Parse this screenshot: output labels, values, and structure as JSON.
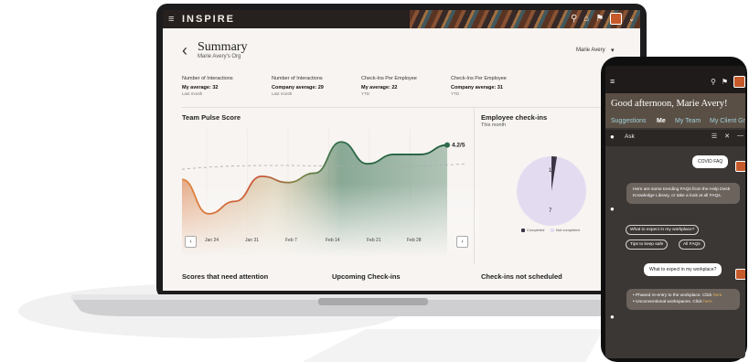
{
  "laptop": {
    "header": {
      "menu_icon": "hamburger-icon",
      "title": "INSPIRE",
      "icons": [
        "search-icon",
        "home-icon",
        "notifications-icon",
        "avatar"
      ]
    },
    "page": {
      "back_icon": "‹",
      "title": "Summary",
      "subtitle": "Marie Avery's Org",
      "user_select": "Marie Avery"
    },
    "metrics": [
      {
        "label": "Number of Interactions",
        "value": "My average: 32",
        "note": "Last month"
      },
      {
        "label": "Number of Interactions",
        "value": "Company average: 29",
        "note": "Last month"
      },
      {
        "label": "Check-Ins Per Employee",
        "value": "My average: 22",
        "note": "YTD"
      },
      {
        "label": "Check-Ins Per Employee",
        "value": "Company average: 31",
        "note": "YTD"
      }
    ],
    "pulse": {
      "title": "Team Pulse Score",
      "current_label": "4.2/5",
      "ticks": [
        "Jan 24",
        "Jan 31",
        "Feb 7",
        "Feb 14",
        "Feb 21",
        "Feb 28"
      ],
      "prev": "‹",
      "next": "›"
    },
    "checkins": {
      "title": "Employee check-ins",
      "subtitle": "This month",
      "completed_label": "1",
      "not_completed_label": "7",
      "legend_completed": "Completed",
      "legend_not_completed": "Not completed"
    },
    "bottom": {
      "scores": "Scores that need attention",
      "upcoming": "Upcoming Check-ins",
      "not_scheduled": "Check-ins not scheduled"
    }
  },
  "chart_data": {
    "type": "area",
    "title": "Team Pulse Score",
    "categories": [
      "Jan 24",
      "Jan 31",
      "Feb 7",
      "Feb 14",
      "Feb 21",
      "Feb 28"
    ],
    "series": [
      {
        "values": [
          3.1,
          2.0,
          2.4,
          3.2,
          3.0,
          3.3,
          4.3,
          3.6,
          3.9,
          3.9,
          4.2
        ]
      }
    ],
    "annotations": [
      "4.2/5"
    ]
  },
  "phone": {
    "greeting": "Good afternoon, Marie Avery!",
    "tabs": [
      "Suggestions",
      "Me",
      "My Team",
      "My Client Gr"
    ],
    "ask": "Ask",
    "messages": {
      "user1": "COVID FAQ",
      "bot1": "Here are some trending FAQs from the Help Desk Knowledge Library, or take a look at all FAQs.",
      "chip1": "What to expect in my workplace?",
      "chip2": "Tips to keep safe",
      "chip3": "All FAQs",
      "user2": "What to expect in my workplace?",
      "bot2_item1": "Phased re-entry to the workplace. Click",
      "bot2_item1_link": "here",
      "bot2_item2": "Unconventional workspaces. Click",
      "bot2_item2_link": "here"
    }
  },
  "colors": {
    "header_bg": "#26201e",
    "chart_green": "#2f6b4a",
    "chart_orange": "#d9743a",
    "pie_dark": "#3a3644",
    "pie_light": "#e3dcf1",
    "phone_link": "#e3b25a"
  }
}
